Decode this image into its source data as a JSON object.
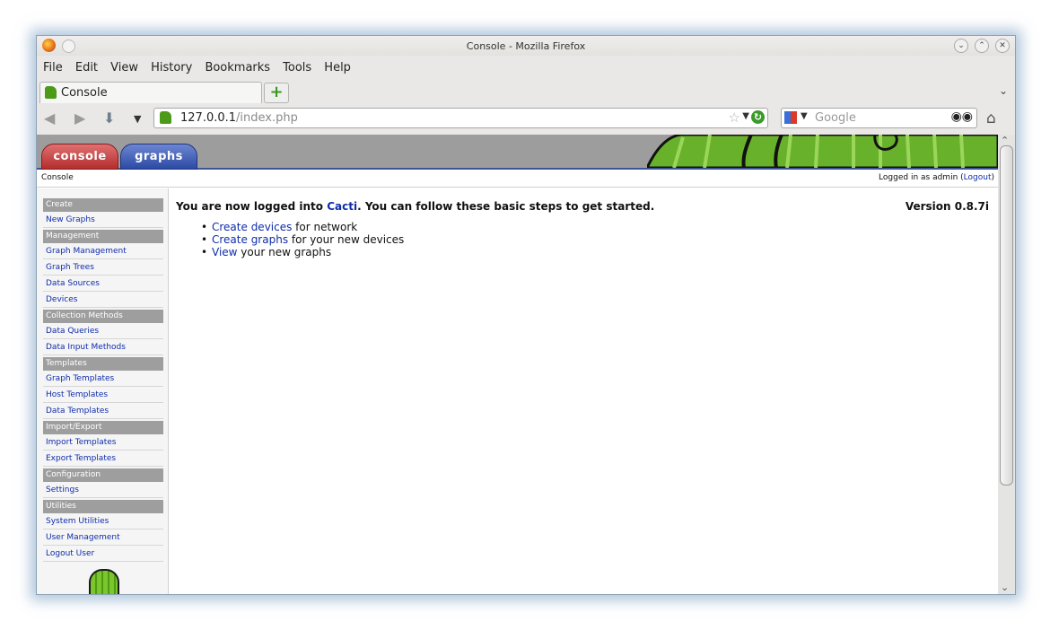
{
  "window": {
    "title": "Console - Mozilla Firefox"
  },
  "menubar": {
    "items": [
      "File",
      "Edit",
      "View",
      "History",
      "Bookmarks",
      "Tools",
      "Help"
    ]
  },
  "tab": {
    "label": "Console",
    "new_tab": "+"
  },
  "urlbar": {
    "host": "127.0.0.1",
    "path": "/index.php"
  },
  "search": {
    "placeholder": "Google"
  },
  "app": {
    "tabs": {
      "console": "console",
      "graphs": "graphs"
    },
    "breadcrumb": "Console",
    "login_text": "Logged in as admin (",
    "logout_label": "Logout",
    "login_close": ")",
    "menu": [
      {
        "type": "header",
        "label": "Create"
      },
      {
        "type": "item",
        "label": "New Graphs"
      },
      {
        "type": "header",
        "label": "Management"
      },
      {
        "type": "item",
        "label": "Graph Management"
      },
      {
        "type": "item",
        "label": "Graph Trees"
      },
      {
        "type": "item",
        "label": "Data Sources"
      },
      {
        "type": "item",
        "label": "Devices"
      },
      {
        "type": "header",
        "label": "Collection Methods"
      },
      {
        "type": "item",
        "label": "Data Queries"
      },
      {
        "type": "item",
        "label": "Data Input Methods"
      },
      {
        "type": "header",
        "label": "Templates"
      },
      {
        "type": "item",
        "label": "Graph Templates"
      },
      {
        "type": "item",
        "label": "Host Templates"
      },
      {
        "type": "item",
        "label": "Data Templates"
      },
      {
        "type": "header",
        "label": "Import/Export"
      },
      {
        "type": "item",
        "label": "Import Templates"
      },
      {
        "type": "item",
        "label": "Export Templates"
      },
      {
        "type": "header",
        "label": "Configuration"
      },
      {
        "type": "item",
        "label": "Settings"
      },
      {
        "type": "header",
        "label": "Utilities"
      },
      {
        "type": "item",
        "label": "System Utilities"
      },
      {
        "type": "item",
        "label": "User Management"
      },
      {
        "type": "item",
        "label": "Logout User"
      }
    ],
    "intro": {
      "before": "You are now logged into ",
      "link": "Cacti",
      "after": ". You can follow these basic steps to get started."
    },
    "version": "Version 0.8.7i",
    "steps": [
      {
        "link": "Create devices",
        "text": " for network"
      },
      {
        "link": "Create graphs",
        "text": " for your new devices"
      },
      {
        "link": "View",
        "text": " your new graphs"
      }
    ]
  }
}
